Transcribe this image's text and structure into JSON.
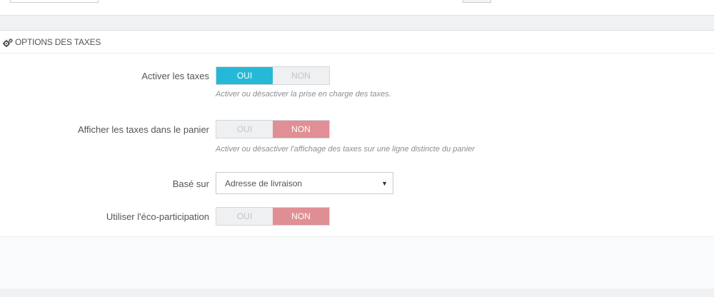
{
  "panel": {
    "title": "OPTIONS DES TAXES",
    "icon": "cogs-icon"
  },
  "fields": {
    "enable_taxes": {
      "label": "Activer les taxes",
      "yes": "OUI",
      "no": "NON",
      "selected": "OUI",
      "help": "Activer ou désactiver la prise en charge des taxes."
    },
    "display_taxes_cart": {
      "label": "Afficher les taxes dans le panier",
      "yes": "OUI",
      "no": "NON",
      "selected": "NON",
      "help": "Activer ou désactiver l'affichage des taxes sur une ligne distincte du panier"
    },
    "based_on": {
      "label": "Basé sur",
      "value": "Adresse de livraison"
    },
    "eco_tax": {
      "label": "Utiliser l'éco-participation",
      "yes": "OUI",
      "no": "NON",
      "selected": "NON"
    }
  },
  "colors": {
    "accent_yes": "#25b9d7",
    "accent_no": "#e08f95"
  }
}
